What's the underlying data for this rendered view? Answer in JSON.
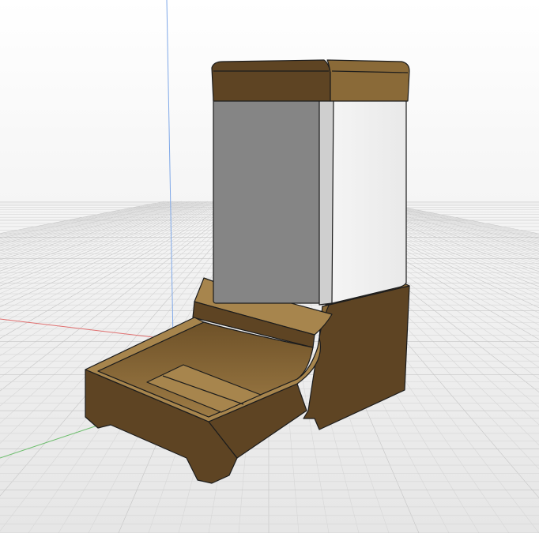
{
  "viewport": {
    "background_top": "#ffffff",
    "background_bottom": "#e8e8e8",
    "grid_minor_color": "#d6d6d6",
    "grid_major_color": "#c4c4c4",
    "axis_colors": {
      "x_axis": "#e07070",
      "y_axis": "#6fbf6f",
      "z_axis": "#7fa8e8"
    }
  },
  "model": {
    "name": "",
    "body_color": "#8a6a38",
    "body_dark": "#5e4423",
    "body_light": "#a7854d",
    "container_front": "#858585",
    "container_side": "#e6e6e6",
    "edge_color": "#1c1c1c"
  }
}
